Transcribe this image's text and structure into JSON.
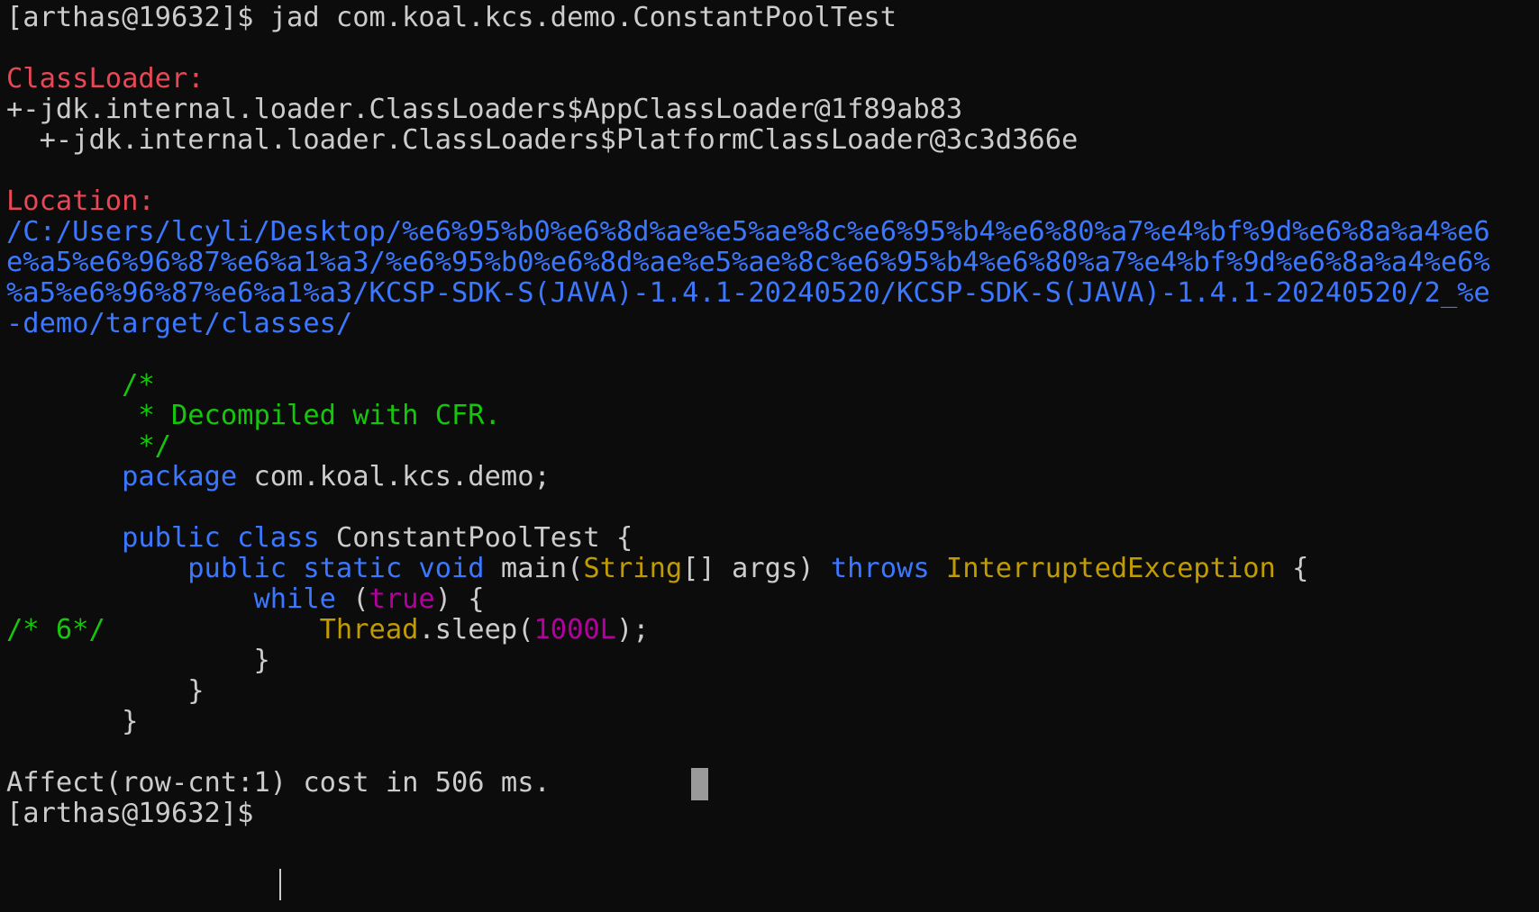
{
  "terminal": {
    "lines": [
      [
        {
          "text": "[arthas@19632]$ jad com.koal.kcs.demo.ConstantPoolTest",
          "color": "default"
        }
      ],
      [],
      [
        {
          "text": "ClassLoader:",
          "color": "red"
        }
      ],
      [
        {
          "text": "+-jdk.internal.loader.ClassLoaders$AppClassLoader@1f89ab83",
          "color": "default"
        }
      ],
      [
        {
          "text": "  +-jdk.internal.loader.ClassLoaders$PlatformClassLoader@3c3d366e",
          "color": "default"
        }
      ],
      [],
      [
        {
          "text": "Location:",
          "color": "red"
        }
      ],
      [
        {
          "text": "/C:/Users/lcyli/Desktop/%e6%95%b0%e6%8d%ae%e5%ae%8c%e6%95%b4%e6%80%a7%e4%bf%9d%e6%8a%a4%e6",
          "color": "blue"
        }
      ],
      [
        {
          "text": "e%a5%e6%96%87%e6%a1%a3/%e6%95%b0%e6%8d%ae%e5%ae%8c%e6%95%b4%e6%80%a7%e4%bf%9d%e6%8a%a4%e6%",
          "color": "blue"
        }
      ],
      [
        {
          "text": "%a5%e6%96%87%e6%a1%a3/KCSP-SDK-S(JAVA)-1.4.1-20240520/KCSP-SDK-S(JAVA)-1.4.1-20240520/2_%e",
          "color": "blue"
        }
      ],
      [
        {
          "text": "-demo/target/classes/",
          "color": "blue"
        }
      ],
      [],
      [
        {
          "text": "       /*",
          "color": "green"
        }
      ],
      [
        {
          "text": "        * Decompiled with CFR.",
          "color": "green"
        }
      ],
      [
        {
          "text": "        */",
          "color": "green"
        }
      ],
      [
        {
          "text": "       ",
          "color": "default"
        },
        {
          "text": "package",
          "color": "blue"
        },
        {
          "text": " com.koal.kcs.demo;",
          "color": "default"
        }
      ],
      [],
      [
        {
          "text": "       ",
          "color": "default"
        },
        {
          "text": "public",
          "color": "blue"
        },
        {
          "text": " ",
          "color": "default"
        },
        {
          "text": "class",
          "color": "blue"
        },
        {
          "text": " ConstantPoolTest {",
          "color": "default"
        }
      ],
      [
        {
          "text": "           ",
          "color": "default"
        },
        {
          "text": "public",
          "color": "blue"
        },
        {
          "text": " ",
          "color": "default"
        },
        {
          "text": "static",
          "color": "blue"
        },
        {
          "text": " ",
          "color": "default"
        },
        {
          "text": "void",
          "color": "blue"
        },
        {
          "text": " main(",
          "color": "default"
        },
        {
          "text": "String",
          "color": "yellow"
        },
        {
          "text": "[] args) ",
          "color": "default"
        },
        {
          "text": "throws",
          "color": "blue"
        },
        {
          "text": " ",
          "color": "default"
        },
        {
          "text": "InterruptedException",
          "color": "yellow"
        },
        {
          "text": " {",
          "color": "default"
        }
      ],
      [
        {
          "text": "               ",
          "color": "default"
        },
        {
          "text": "while",
          "color": "blue"
        },
        {
          "text": " (",
          "color": "default"
        },
        {
          "text": "true",
          "color": "magenta"
        },
        {
          "text": ") {",
          "color": "default"
        }
      ],
      [
        {
          "text": "/* 6*/",
          "color": "green"
        },
        {
          "text": "             ",
          "color": "default"
        },
        {
          "text": "Thread",
          "color": "yellow"
        },
        {
          "text": ".sleep(",
          "color": "default"
        },
        {
          "text": "1000L",
          "color": "magenta"
        },
        {
          "text": ");",
          "color": "default"
        }
      ],
      [
        {
          "text": "               }",
          "color": "default"
        }
      ],
      [
        {
          "text": "           }",
          "color": "default"
        }
      ],
      [
        {
          "text": "       }",
          "color": "default"
        }
      ],
      [],
      [
        {
          "text": "Affect(row-cnt:1) cost in 506 ms.",
          "color": "default"
        }
      ],
      [
        {
          "text": "[arthas@19632]$ ",
          "color": "default"
        }
      ]
    ]
  },
  "colors": {
    "background": "#0c0c0c",
    "default": "#cccccc",
    "red": "#e74856",
    "blue": "#3b78ff",
    "green": "#16c60c",
    "yellow": "#c19c00",
    "magenta": "#b4009e"
  }
}
